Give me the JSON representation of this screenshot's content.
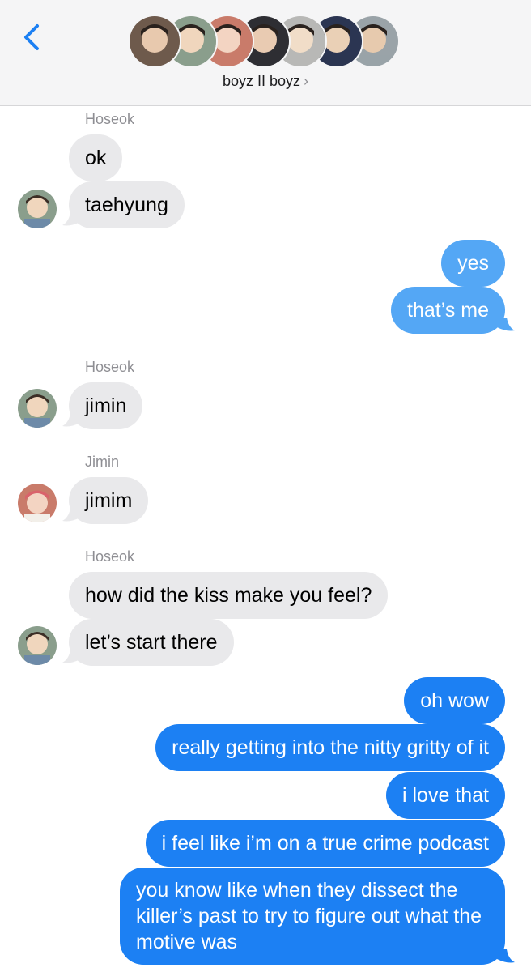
{
  "header": {
    "group_name": "boyz II boyz",
    "chevron": "›",
    "back_icon": "chevron-left-icon",
    "accent": "#1c80f3",
    "avatars": [
      {
        "bg": "#6e5a4c",
        "face": "#e8c9ae"
      },
      {
        "bg": "#8a9e8c",
        "face": "#f0d6bd"
      },
      {
        "bg": "#c97b6a",
        "face": "#f3d4c2"
      },
      {
        "bg": "#2e2e33",
        "face": "#e9cbb2"
      },
      {
        "bg": "#b8b8b6",
        "face": "#f1ddc8"
      },
      {
        "bg": "#2b3552",
        "face": "#ead0b6"
      },
      {
        "bg": "#9aa3a8",
        "face": "#e7caae"
      }
    ]
  },
  "messages": {
    "s1": "Hoseok",
    "m1": "ok",
    "m2": "taehyung",
    "m3": "yes",
    "m4": "that’s me",
    "s2": "Hoseok",
    "m5": "jimin",
    "s3": "Jimin",
    "m6": "jimim",
    "s4": "Hoseok",
    "m7": "how did the kiss make you feel?",
    "m8": "let’s start there",
    "m9": "oh wow",
    "m10": "really getting into the nitty gritty of it",
    "m11": "i love that",
    "m12": "i feel like i’m on a true crime podcast",
    "m13": "you know like when they dissect the killer’s past to try to figure out what the motive was"
  },
  "colors": {
    "incoming": "#e9e9eb",
    "outgoing": "#1c80f3",
    "outgoing_faded": "#54a7f5"
  }
}
